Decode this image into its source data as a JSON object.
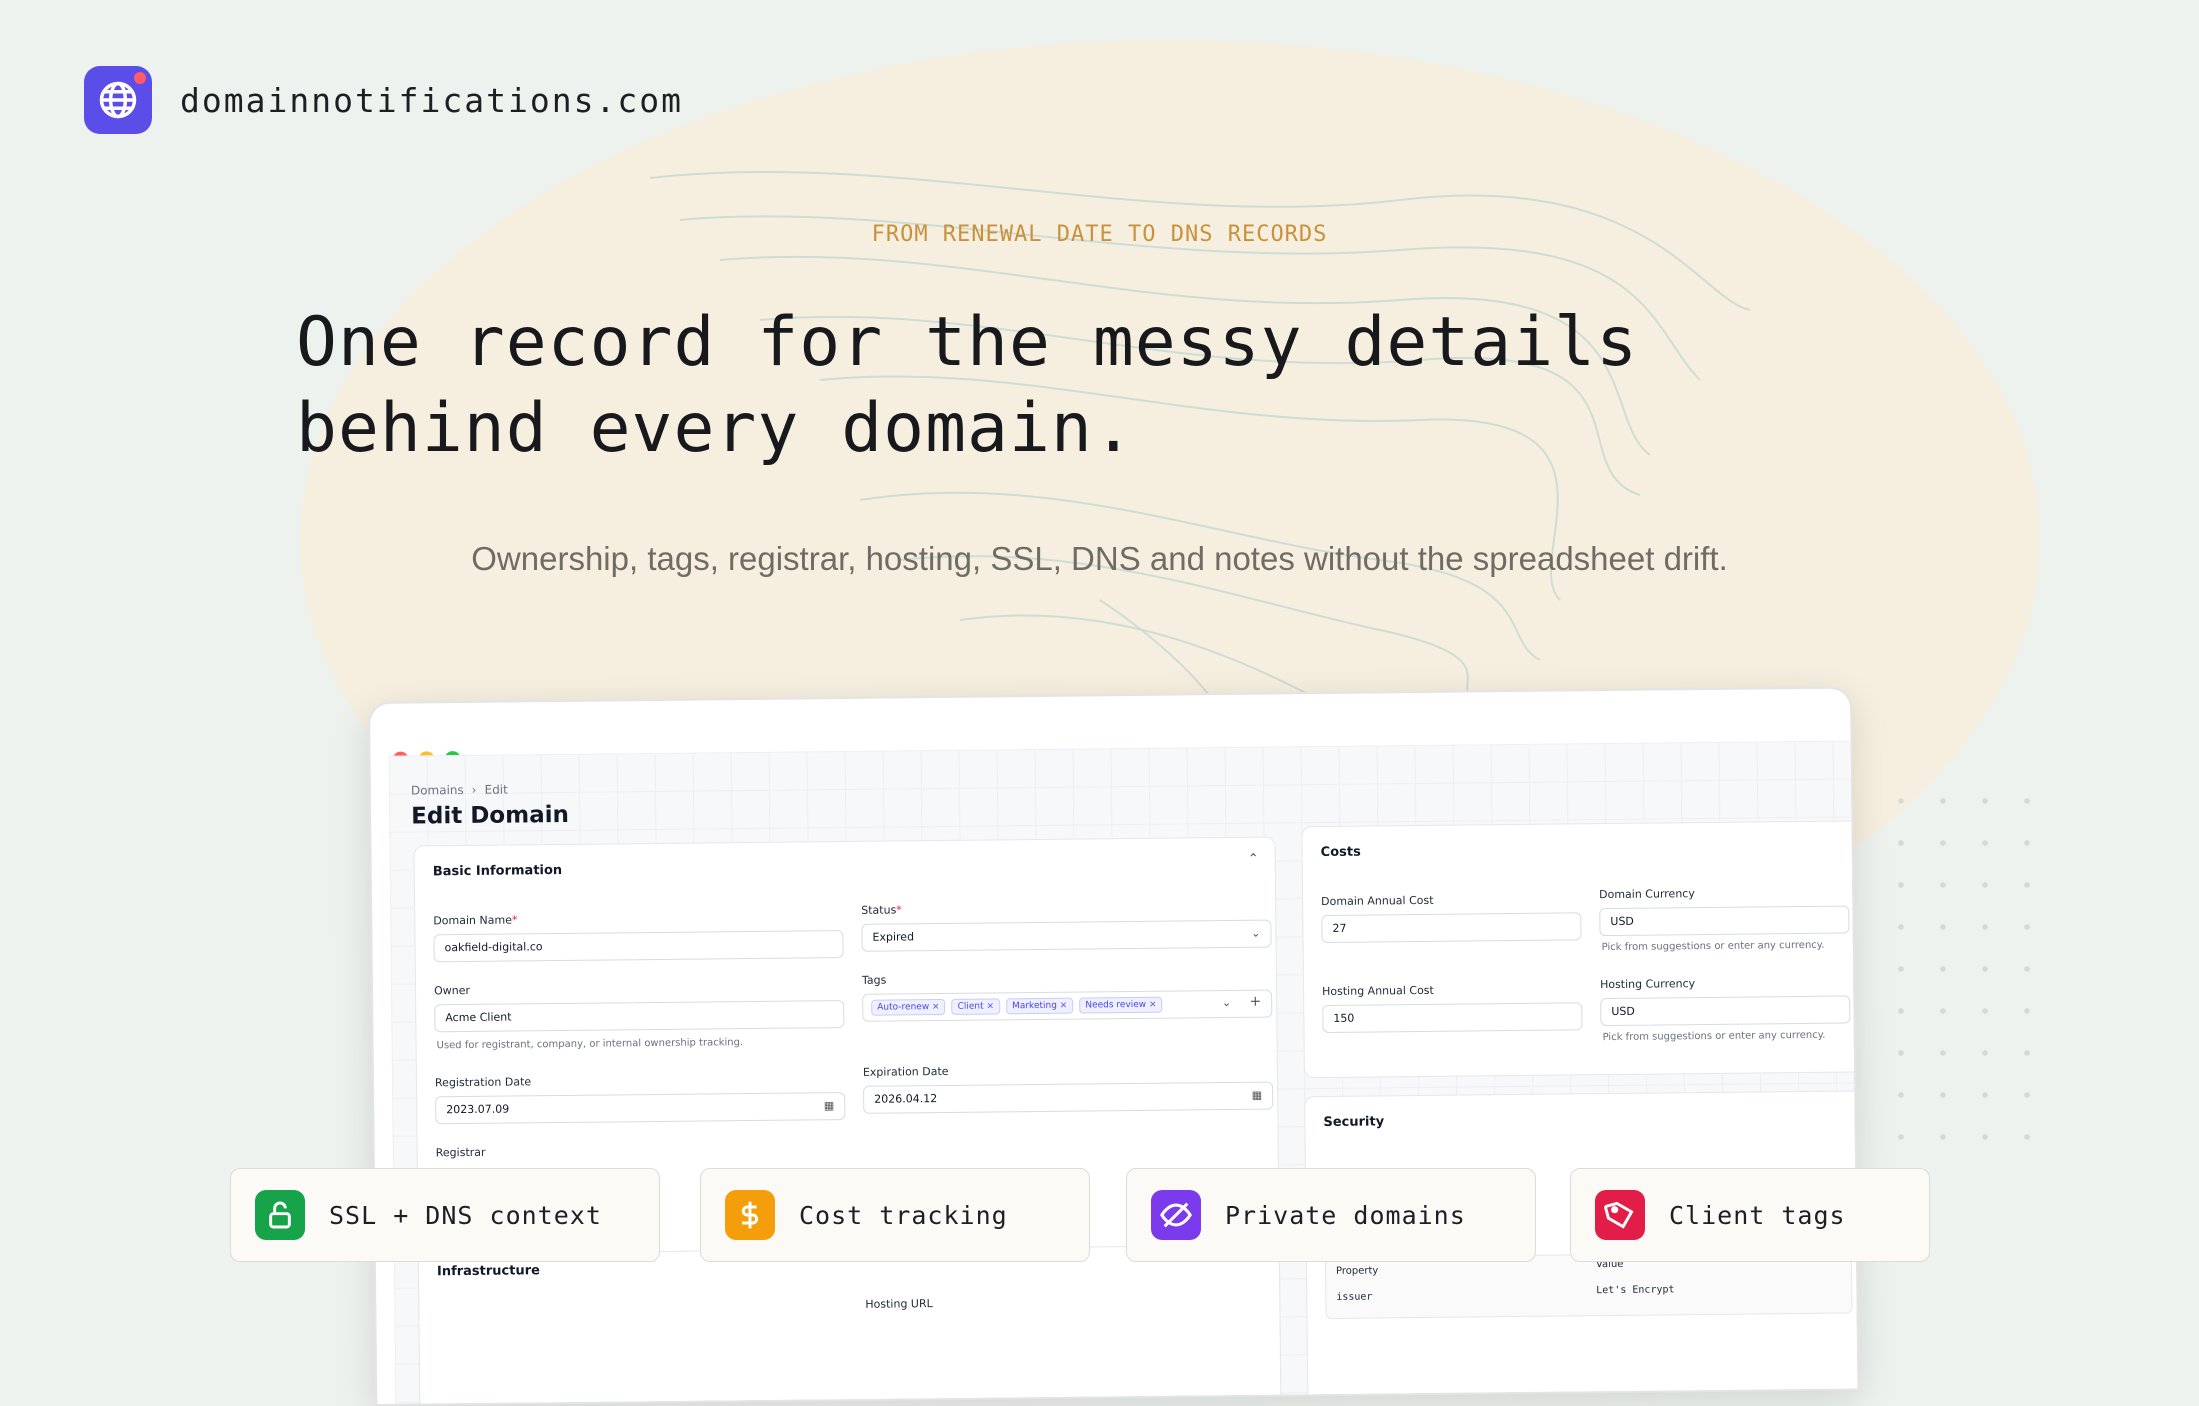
{
  "brand": {
    "name": "domainnotifications.com"
  },
  "hero": {
    "eyebrow": "FROM RENEWAL DATE TO DNS RECORDS",
    "headline_line1": "One record for the messy details",
    "headline_line2": "behind every domain.",
    "subline": "Ownership, tags, registrar, hosting, SSL, DNS and notes without the spreadsheet drift."
  },
  "colors": {
    "accent": "#5b4de8",
    "eyebrow": "#c8913c",
    "blob": "#f6efdf",
    "background": "#eef2ee"
  },
  "app": {
    "breadcrumb": {
      "root": "Domains",
      "current": "Edit"
    },
    "page_title": "Edit Domain",
    "basic_info": {
      "title": "Basic Information",
      "domain_name_label": "Domain Name",
      "domain_name_value": "oakfield-digital.co",
      "status_label": "Status",
      "status_value": "Expired",
      "owner_label": "Owner",
      "owner_value": "Acme Client",
      "owner_hint": "Used for registrant, company, or internal ownership tracking.",
      "tags_label": "Tags",
      "tags": [
        "Auto-renew",
        "Client",
        "Marketing",
        "Needs review"
      ],
      "registration_label": "Registration Date",
      "registration_value": "2023.07.09",
      "expiration_label": "Expiration Date",
      "expiration_value": "2026.04.12",
      "registrar_label": "Registrar"
    },
    "costs": {
      "title": "Costs",
      "domain_cost_label": "Domain Annual Cost",
      "domain_cost_value": "27",
      "domain_currency_label": "Domain Currency",
      "domain_currency_value": "USD",
      "currency_hint": "Pick from suggestions or enter any currency.",
      "hosting_cost_label": "Hosting Annual Cost",
      "hosting_cost_value": "150",
      "hosting_currency_label": "Hosting Currency",
      "hosting_currency_value": "USD"
    },
    "security": {
      "title": "Security",
      "property_header": "Property",
      "value_header": "Value",
      "row_property": "issuer",
      "row_value": "Let's Encrypt"
    },
    "infrastructure": {
      "title": "Infrastructure",
      "hosting_url_label": "Hosting URL"
    }
  },
  "features": [
    {
      "label": "SSL + DNS context",
      "icon": "lock-open-icon",
      "color": "#16a34a"
    },
    {
      "label": "Cost tracking",
      "icon": "dollar-icon",
      "color": "#f59e0b"
    },
    {
      "label": "Private domains",
      "icon": "eye-off-icon",
      "color": "#7c3aed"
    },
    {
      "label": "Client tags",
      "icon": "tag-icon",
      "color": "#e11d48"
    }
  ]
}
